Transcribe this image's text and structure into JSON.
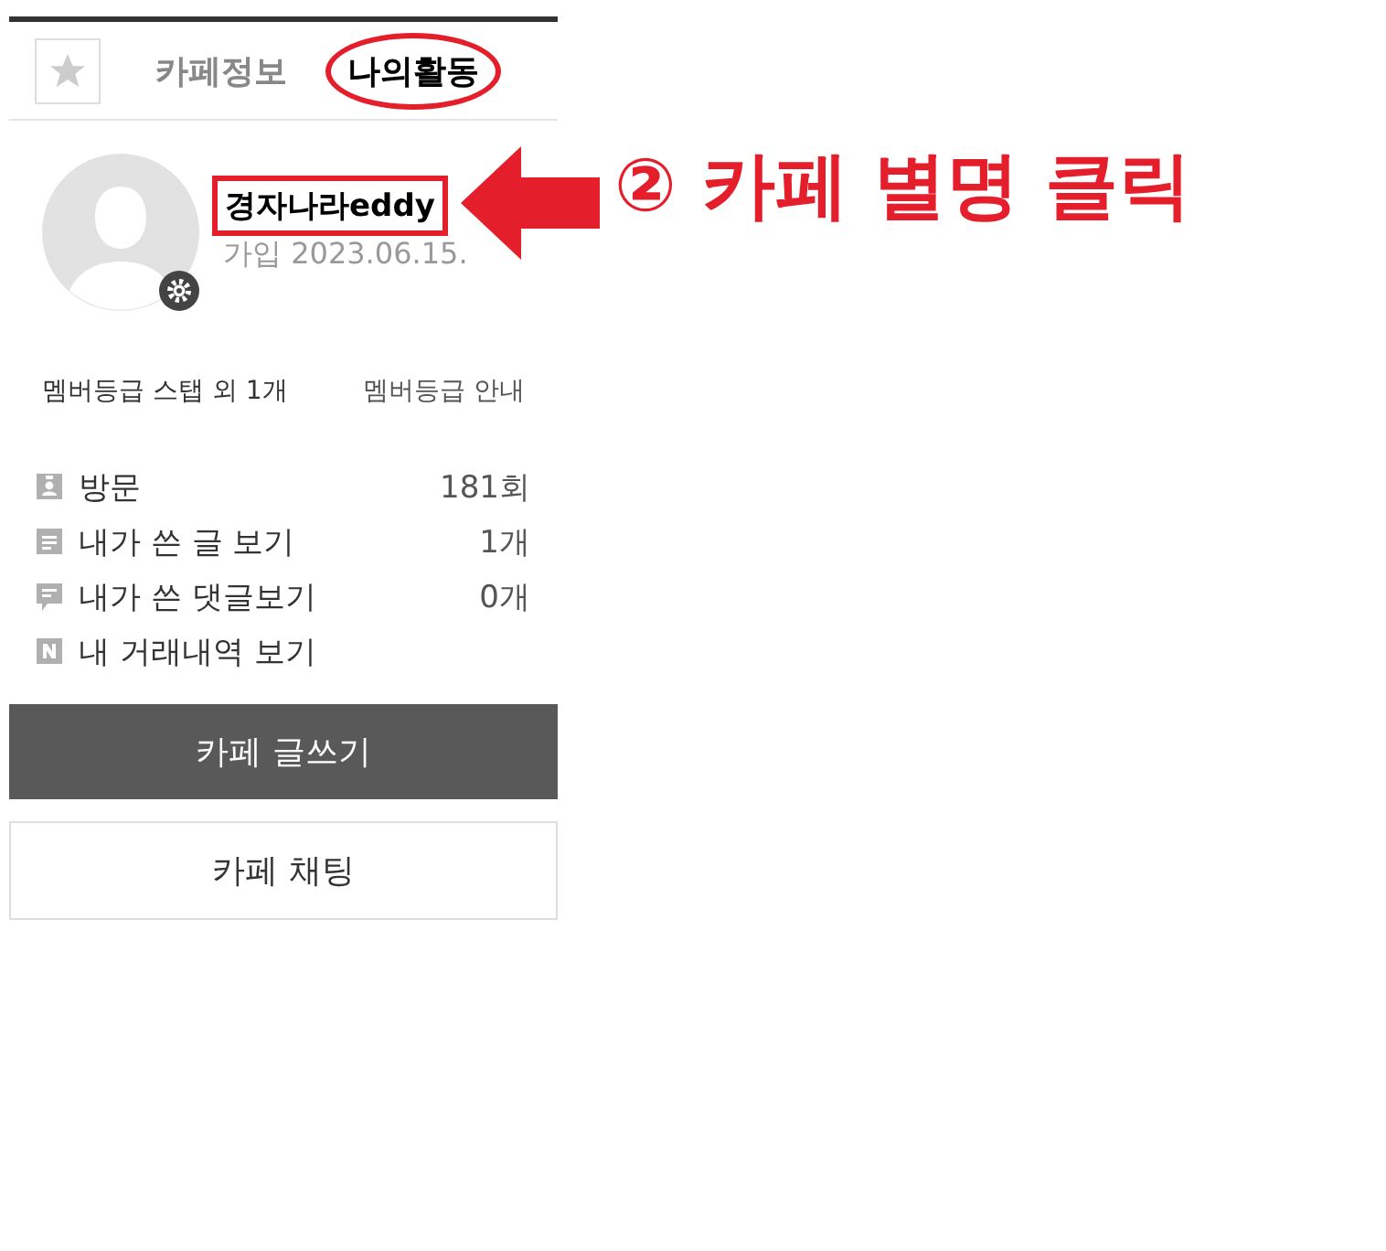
{
  "tabs": [
    {
      "label": "카페정보",
      "selected": false
    },
    {
      "label": "나의활동",
      "selected": true
    }
  ],
  "profile": {
    "nickname": "경자나라eddy",
    "joined": "가입 2023.06.15."
  },
  "grade": {
    "badges": "멤버등급 스탭 외 1개",
    "guide": "멤버등급 안내"
  },
  "stats": [
    {
      "kind": "visit",
      "label": "방문",
      "value": "181회"
    },
    {
      "kind": "posts",
      "label": "내가 쓴 글 보기",
      "value": "1개"
    },
    {
      "kind": "comments",
      "label": "내가 쓴 댓글보기",
      "value": "0개"
    },
    {
      "kind": "trades",
      "label": "내 거래내역 보기"
    }
  ],
  "buttons": [
    {
      "kind": "primary",
      "label": "카페 글쓰기"
    },
    {
      "kind": "secondary",
      "label": "카페 채팅"
    }
  ],
  "annotation": {
    "text": "② 카페 별명 클릭"
  }
}
